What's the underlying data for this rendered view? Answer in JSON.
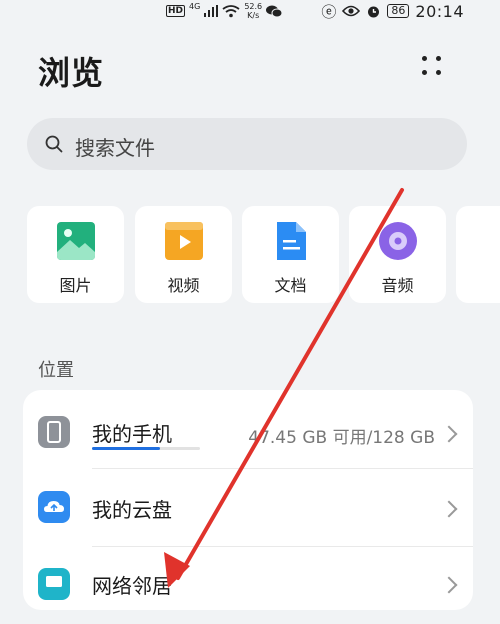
{
  "status_bar": {
    "hd": "HD",
    "network": "4G",
    "speed": "52.6",
    "speed_unit": "K/s",
    "battery": "86",
    "time": "20:14"
  },
  "header": {
    "title": "浏览"
  },
  "search": {
    "placeholder": "搜索文件"
  },
  "categories": [
    {
      "label": "图片",
      "icon": "image-icon",
      "color": "#22b07d"
    },
    {
      "label": "视频",
      "icon": "video-icon",
      "color": "#f5a623"
    },
    {
      "label": "文档",
      "icon": "document-icon",
      "color": "#2b8cf3"
    },
    {
      "label": "音频",
      "icon": "audio-icon",
      "color": "#8a63e6"
    }
  ],
  "locations": {
    "title": "位置",
    "items": [
      {
        "name": "我的手机",
        "meta": "47.45 GB 可用/128 GB",
        "icon": "phone-icon",
        "usage": 0.63
      },
      {
        "name": "我的云盘",
        "meta": "",
        "icon": "cloud-drive-icon"
      },
      {
        "name": "网络邻居",
        "meta": "",
        "icon": "network-icon"
      }
    ]
  },
  "colors": {
    "accent": "#1f6fe0",
    "annotation_arrow": "#e0332c"
  }
}
